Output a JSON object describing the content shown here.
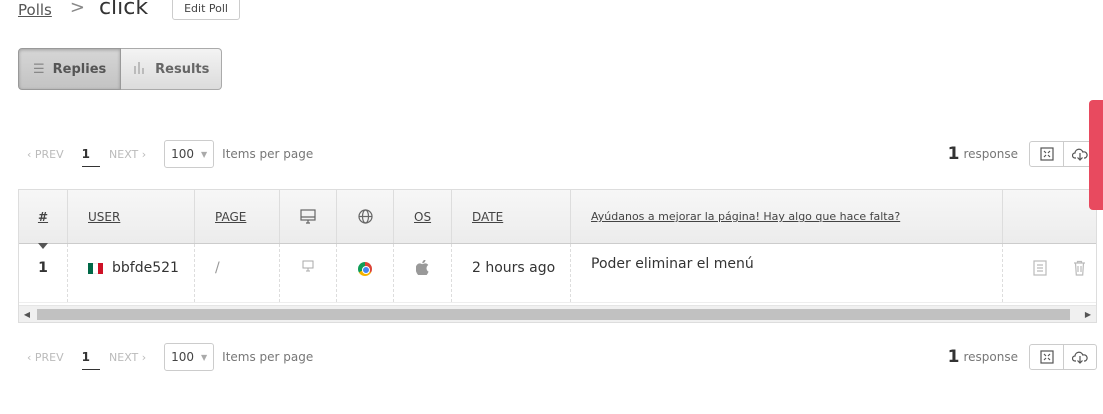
{
  "breadcrumb": {
    "parent": "Polls",
    "separator": ">",
    "title": "click",
    "edit_label": "Edit Poll"
  },
  "tabs": [
    {
      "label": "Replies",
      "icon": "list-icon",
      "active": true
    },
    {
      "label": "Results",
      "icon": "bar-chart-icon",
      "active": false
    }
  ],
  "pager": {
    "prev": "‹ PREV",
    "page": "1",
    "next": "NEXT ›",
    "per_page": "100",
    "per_page_label": "Items per page",
    "response_count": "1",
    "response_label": "response"
  },
  "table": {
    "headers": {
      "num": "#",
      "user": "USER",
      "page": "PAGE",
      "device": "monitor-icon",
      "browser": "globe-icon",
      "os": "OS",
      "date": "DATE",
      "question": "Ayúdanos a mejorar la página! Hay algo que hace falta?"
    },
    "rows": [
      {
        "num": "1",
        "user": "bbfde521",
        "flag": "mexico-flag-icon",
        "page": "/",
        "device": "desktop-icon",
        "browser": "chrome-icon",
        "os": "apple-icon",
        "date": "2 hours ago",
        "answer": "Poder eliminar el menú"
      }
    ]
  },
  "colors": {
    "accent_side_tab": "#e84a5f",
    "flag_green": "#006847",
    "flag_red": "#ce1126"
  }
}
